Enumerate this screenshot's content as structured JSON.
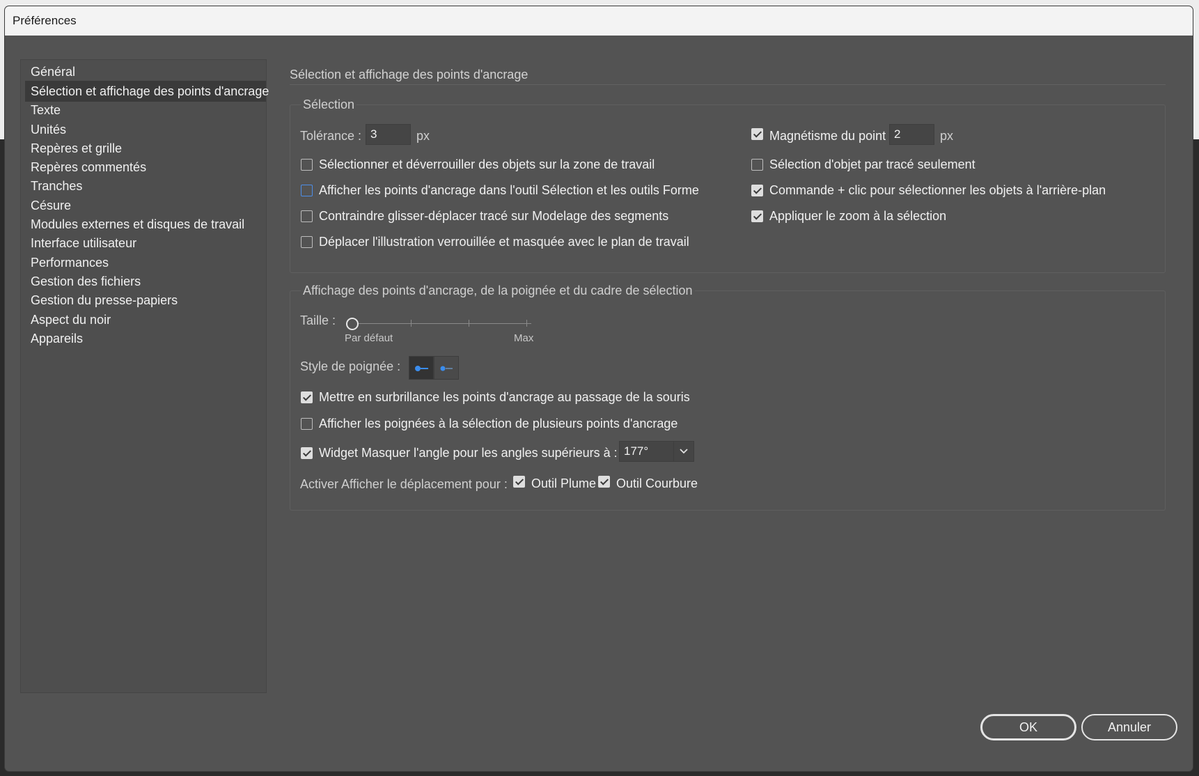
{
  "window": {
    "title": "Préférences"
  },
  "sidebar": {
    "items": [
      {
        "label": "Général"
      },
      {
        "label": "Sélection et affichage des points d'ancrage"
      },
      {
        "label": "Texte"
      },
      {
        "label": "Unités"
      },
      {
        "label": "Repères et grille"
      },
      {
        "label": "Repères commentés"
      },
      {
        "label": "Tranches"
      },
      {
        "label": "Césure"
      },
      {
        "label": "Modules externes et disques de travail"
      },
      {
        "label": "Interface utilisateur"
      },
      {
        "label": "Performances"
      },
      {
        "label": "Gestion des fichiers"
      },
      {
        "label": "Gestion du presse-papiers"
      },
      {
        "label": "Aspect du noir"
      },
      {
        "label": "Appareils"
      }
    ],
    "selected_index": 1
  },
  "main": {
    "title": "Sélection et affichage des points d'ancrage",
    "selection_group": {
      "title": "Sélection",
      "tolerance_label": "Tolérance :",
      "tolerance_value": "3",
      "tolerance_unit": "px",
      "snap_label": "Magnétisme du point",
      "snap_value": "2",
      "snap_unit": "px",
      "snap_checked": true,
      "checkboxes_left": [
        {
          "label": "Sélectionner et déverrouiller des objets sur la zone de travail",
          "checked": false
        },
        {
          "label": "Afficher les points d'ancrage dans l'outil Sélection et les outils Forme",
          "checked": false
        },
        {
          "label": "Contraindre glisser-déplacer tracé sur Modelage des segments",
          "checked": false
        },
        {
          "label": "Déplacer l'illustration verrouillée et masquée avec le plan de travail",
          "checked": false
        }
      ],
      "checkboxes_right": [
        {
          "label": "Sélection d'objet par tracé seulement",
          "checked": false
        },
        {
          "label": "Commande + clic pour sélectionner les objets à l'arrière-plan",
          "checked": true
        },
        {
          "label": "Appliquer le zoom à la sélection",
          "checked": true
        }
      ]
    },
    "display_group": {
      "title": "Affichage des points d'ancrage, de la poignée et du cadre de sélection",
      "size_label": "Taille :",
      "size_min_label": "Par défaut",
      "size_max_label": "Max",
      "size_level": 0,
      "handle_style_label": "Style de poignée :",
      "checkboxes": [
        {
          "label": "Mettre en surbrillance les points d'ancrage au passage de la souris",
          "checked": true
        },
        {
          "label": "Afficher les poignées à la sélection de plusieurs points d'ancrage",
          "checked": false
        },
        {
          "label": "Widget Masquer l'angle pour les angles supérieurs à :",
          "checked": true
        }
      ],
      "angle_value": "177°",
      "enable_move_label": "Activer Afficher le déplacement pour :",
      "pen_tool_label": "Outil Plume",
      "pen_tool_checked": true,
      "curvature_tool_label": "Outil Courbure",
      "curvature_tool_checked": true
    }
  },
  "buttons": {
    "ok": "OK",
    "cancel": "Annuler"
  },
  "colors": {
    "dialog_bg": "#535353",
    "selected_item_bg": "#3a3a3a",
    "focus_accent": "#4d8ee8"
  }
}
